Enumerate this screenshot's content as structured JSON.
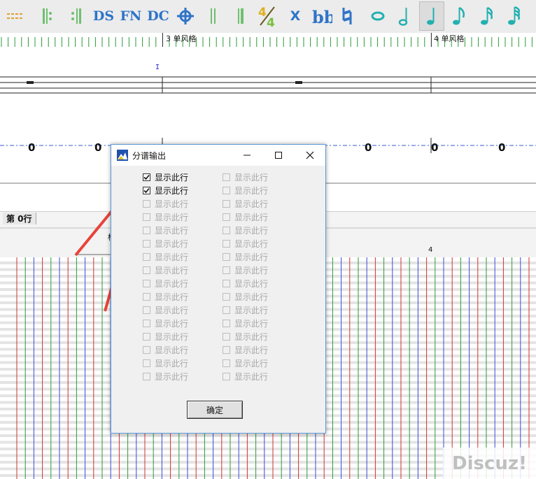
{
  "toolbar": {
    "buttons": [
      {
        "icon": "lines-icon"
      },
      {
        "icon": "repeat-start-icon"
      },
      {
        "icon": "repeat-end-icon"
      },
      {
        "label": "DS"
      },
      {
        "label": "FN"
      },
      {
        "label": "DC"
      },
      {
        "icon": "coda-icon"
      },
      {
        "icon": "barline-double-icon"
      },
      {
        "icon": "barline-final-icon"
      },
      {
        "label": "4/4"
      },
      {
        "label": "X"
      },
      {
        "label": "bb"
      },
      {
        "label": "♮"
      },
      {
        "label": "𝅝"
      },
      {
        "label": "𝅗𝅥"
      },
      {
        "label": "♩"
      },
      {
        "label": "♪"
      },
      {
        "label": "𝅘𝅥𝅯"
      },
      {
        "label": "𝅘𝅥𝅰"
      }
    ],
    "active_index": 15
  },
  "ruler": {
    "label_a": "3 单风格",
    "label_b": "4 单风格"
  },
  "staff": {
    "cursor_mark": "I",
    "digits": [
      "0",
      "0",
      "0",
      "0",
      "0"
    ]
  },
  "row_label": "第 0行",
  "lower": {
    "measure_number": "4",
    "partial_text": "桶"
  },
  "dialog": {
    "title": "分谱输出",
    "minimize": "—",
    "maximize": "☐",
    "close": "✕",
    "left_column": [
      {
        "label": "显示此行",
        "checked": true,
        "enabled": true
      },
      {
        "label": "显示此行",
        "checked": true,
        "enabled": true
      },
      {
        "label": "显示此行",
        "checked": false,
        "enabled": false
      },
      {
        "label": "显示此行",
        "checked": false,
        "enabled": false
      },
      {
        "label": "显示此行",
        "checked": false,
        "enabled": false
      },
      {
        "label": "显示此行",
        "checked": false,
        "enabled": false
      },
      {
        "label": "显示此行",
        "checked": false,
        "enabled": false
      },
      {
        "label": "显示此行",
        "checked": false,
        "enabled": false
      },
      {
        "label": "显示此行",
        "checked": false,
        "enabled": false
      },
      {
        "label": "显示此行",
        "checked": false,
        "enabled": false
      },
      {
        "label": "显示此行",
        "checked": false,
        "enabled": false
      },
      {
        "label": "显示此行",
        "checked": false,
        "enabled": false
      },
      {
        "label": "显示此行",
        "checked": false,
        "enabled": false
      },
      {
        "label": "显示此行",
        "checked": false,
        "enabled": false
      },
      {
        "label": "显示此行",
        "checked": false,
        "enabled": false
      },
      {
        "label": "显示此行",
        "checked": false,
        "enabled": false
      }
    ],
    "right_column": [
      {
        "label": "显示此行",
        "checked": false,
        "enabled": false
      },
      {
        "label": "显示此行",
        "checked": false,
        "enabled": false
      },
      {
        "label": "显示此行",
        "checked": false,
        "enabled": false
      },
      {
        "label": "显示此行",
        "checked": false,
        "enabled": false
      },
      {
        "label": "显示此行",
        "checked": false,
        "enabled": false
      },
      {
        "label": "显示此行",
        "checked": false,
        "enabled": false
      },
      {
        "label": "显示此行",
        "checked": false,
        "enabled": false
      },
      {
        "label": "显示此行",
        "checked": false,
        "enabled": false
      },
      {
        "label": "显示此行",
        "checked": false,
        "enabled": false
      },
      {
        "label": "显示此行",
        "checked": false,
        "enabled": false
      },
      {
        "label": "显示此行",
        "checked": false,
        "enabled": false
      },
      {
        "label": "显示此行",
        "checked": false,
        "enabled": false
      },
      {
        "label": "显示此行",
        "checked": false,
        "enabled": false
      },
      {
        "label": "显示此行",
        "checked": false,
        "enabled": false
      },
      {
        "label": "显示此行",
        "checked": false,
        "enabled": false
      },
      {
        "label": "显示此行",
        "checked": false,
        "enabled": false
      }
    ],
    "ok_label": "确定"
  },
  "watermark": "Discuz!",
  "colors": {
    "accent_blue": "#2f74c8",
    "note_teal": "#22b0b0",
    "arrow_red": "#e8433a",
    "grid_red": "#d23030",
    "grid_green": "#2a9a3a",
    "grid_blue": "#3a4ad8"
  }
}
